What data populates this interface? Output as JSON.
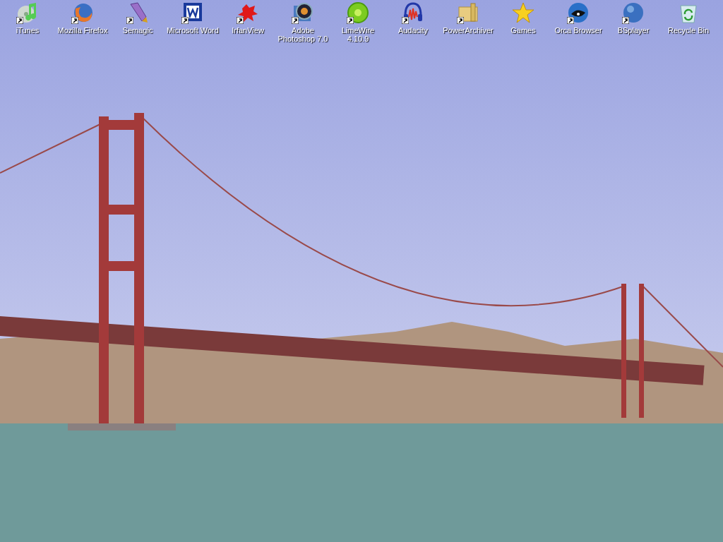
{
  "desktop_icons": [
    {
      "label": "iTunes",
      "kind": "music",
      "shortcut": true
    },
    {
      "label": "Mozilla Firefox",
      "kind": "firefox",
      "shortcut": true
    },
    {
      "label": "Semagic",
      "kind": "pen",
      "shortcut": true
    },
    {
      "label": "Microsoft Word",
      "kind": "document",
      "shortcut": true
    },
    {
      "label": "IrfanView",
      "kind": "splat",
      "shortcut": true
    },
    {
      "label": "Adobe Photoshop 7.0",
      "kind": "eye",
      "shortcut": true
    },
    {
      "label": "LimeWire 4.10.9",
      "kind": "lime",
      "shortcut": true
    },
    {
      "label": "Audacity",
      "kind": "headphones",
      "shortcut": true
    },
    {
      "label": "PowerArchiver",
      "kind": "archive",
      "shortcut": true
    },
    {
      "label": "Games",
      "kind": "star",
      "shortcut": false
    },
    {
      "label": "Orca Browser",
      "kind": "orca",
      "shortcut": true
    },
    {
      "label": "BSplayer",
      "kind": "ball",
      "shortcut": true
    },
    {
      "label": "Recycle Bin",
      "kind": "recycle",
      "shortcut": false
    }
  ]
}
